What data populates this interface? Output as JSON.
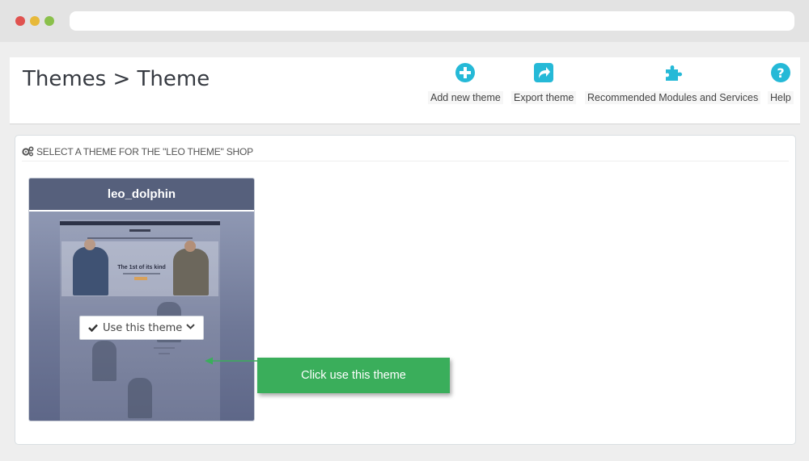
{
  "browser": {
    "window_buttons": [
      "close",
      "minimize",
      "maximize"
    ],
    "address": ""
  },
  "header": {
    "title": "Themes > Theme",
    "toolbar": [
      {
        "id": "add",
        "label": "Add new theme",
        "icon": "plus-circle-icon"
      },
      {
        "id": "export",
        "label": "Export theme",
        "icon": "share-icon"
      },
      {
        "id": "modules",
        "label": "Recommended Modules and Services",
        "icon": "puzzle-icon"
      },
      {
        "id": "help",
        "label": "Help",
        "icon": "question-circle-icon"
      }
    ]
  },
  "panel": {
    "heading": "SELECT A THEME FOR THE \"LEO THEME\" SHOP",
    "heading_icon": "cogs-icon",
    "theme": {
      "name": "leo_dolphin",
      "preview_headline": "The 1st of its kind",
      "action_label": "Use this theme",
      "action_icon": "check-icon"
    }
  },
  "callout": {
    "text": "Click use this theme"
  },
  "colors": {
    "accent_blue": "#25b9d7",
    "card_header": "#56607c",
    "callout_green": "#3aae5b"
  }
}
